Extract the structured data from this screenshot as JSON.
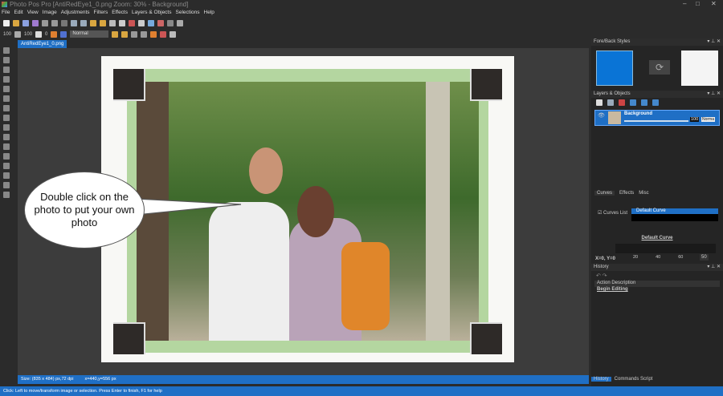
{
  "window": {
    "title": "Photo Pos Pro [AntiRedEye1_0.png Zoom: 30% - Background]",
    "controls": [
      "–",
      "□",
      "✕"
    ]
  },
  "menu": [
    "File",
    "Edit",
    "View",
    "Image",
    "Adjustments",
    "Filters",
    "Effects",
    "Layers & Objects",
    "Selections",
    "Help"
  ],
  "toolbar2": {
    "opacity1": "100",
    "opacity2": "100",
    "value3": "0",
    "blend_mode": "Normal"
  },
  "document_tab": "AntiRedEye1_0.png",
  "callout": "Double click on the photo to put your own photo",
  "status": {
    "size": "Size: (835 x 484) px,72 dpi",
    "coords": "x=440,y=556 px",
    "hint": "Click: Left to move/transform image or selection. Press Enter to finish, F1 for help"
  },
  "panels": {
    "fore_back": {
      "title": "Fore/Back Styles",
      "fore_color": "#0a74d6",
      "back_color": "#f4f4f4"
    },
    "layers": {
      "title": "Layers & Objects",
      "layer_name": "Background",
      "opacity": "100",
      "blend": "Norma"
    },
    "curves": {
      "tabs": [
        "Curves",
        "Effects",
        "Misc"
      ],
      "list_label": "Curves List",
      "selected_curve": "Default Curve",
      "curve_title": "Default Curve",
      "x_ticks": [
        "20",
        "40",
        "60",
        "80"
      ],
      "coords": "X=0, Y=0",
      "value": "50"
    },
    "history": {
      "title": "History",
      "column": "Action Description",
      "items": [
        "Begin Editing"
      ],
      "tabs": [
        "History",
        "Commands Script"
      ]
    }
  },
  "colors": {
    "accent": "#1f6fc5",
    "frame_green": "#b4d6a0"
  }
}
